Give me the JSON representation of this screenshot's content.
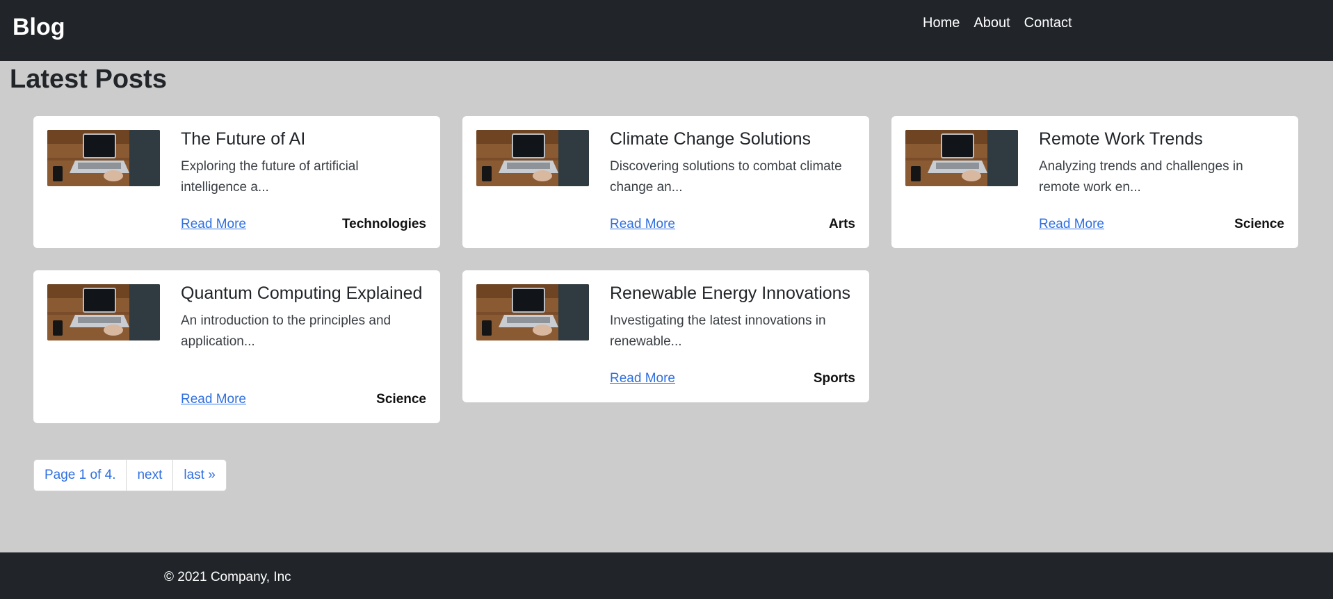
{
  "navbar": {
    "brand": "Blog",
    "links": [
      {
        "label": "Home"
      },
      {
        "label": "About"
      },
      {
        "label": "Contact"
      }
    ]
  },
  "main": {
    "heading": "Latest Posts",
    "posts": [
      {
        "title": "The Future of AI",
        "excerpt": "Exploring the future of artificial intelligence a...",
        "read_more": "Read More",
        "category": "Technologies",
        "image_icon": "laptop-photo"
      },
      {
        "title": "Climate Change Solutions",
        "excerpt": "Discovering solutions to combat climate change an...",
        "read_more": "Read More",
        "category": "Arts",
        "image_icon": "laptop-photo"
      },
      {
        "title": "Remote Work Trends",
        "excerpt": "Analyzing trends and challenges in remote work en...",
        "read_more": "Read More",
        "category": "Science",
        "image_icon": "laptop-photo"
      },
      {
        "title": "Quantum Computing Explained",
        "excerpt": "An introduction to the principles and application...",
        "read_more": "Read More",
        "category": "Science",
        "image_icon": "laptop-photo"
      },
      {
        "title": "Renewable Energy Innovations",
        "excerpt": "Investigating the latest innovations in renewable...",
        "read_more": "Read More",
        "category": "Sports",
        "image_icon": "laptop-photo"
      }
    ]
  },
  "pagination": {
    "current": "Page 1 of 4.",
    "next": "next",
    "last": "last »"
  },
  "footer": {
    "copyright": "© 2021 Company, Inc"
  },
  "colors": {
    "navbar_bg": "#212529",
    "page_bg": "#cccccc",
    "link": "#2f6fe0"
  }
}
